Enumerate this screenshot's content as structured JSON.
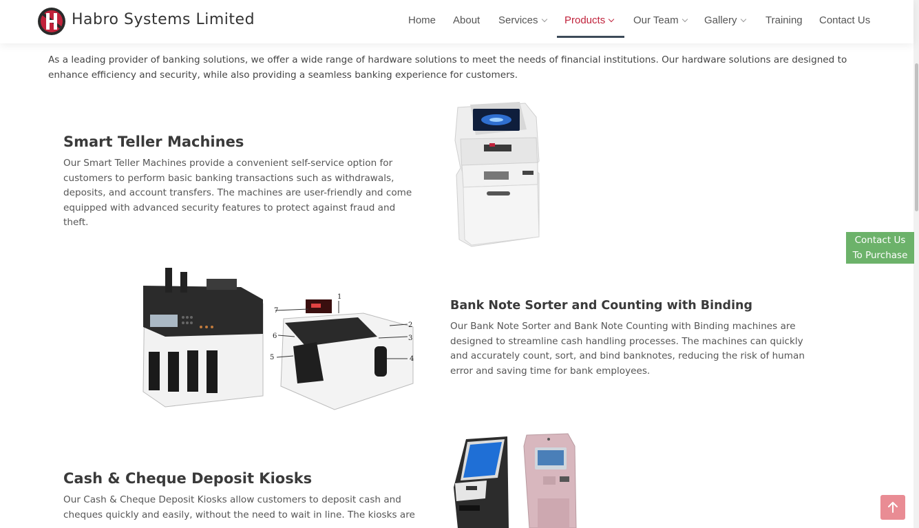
{
  "brand": {
    "name": "Habro Systems Limited"
  },
  "nav": {
    "items": [
      {
        "label": "Home",
        "dropdown": false
      },
      {
        "label": "About",
        "dropdown": false
      },
      {
        "label": "Services",
        "dropdown": true
      },
      {
        "label": "Products",
        "dropdown": true,
        "active": true
      },
      {
        "label": "Our Team",
        "dropdown": true
      },
      {
        "label": "Gallery",
        "dropdown": true
      },
      {
        "label": "Training",
        "dropdown": false
      },
      {
        "label": "Contact Us",
        "dropdown": false
      }
    ]
  },
  "intro": "As a leading provider of banking solutions, we offer a wide range of hardware solutions to meet the needs of financial institutions. Our hardware solutions are designed to enhance efficiency and security, while also providing a seamless banking experience for customers.",
  "products": [
    {
      "title": "Smart Teller Machines",
      "description": "Our Smart Teller Machines provide a convenient self-service option for customers to perform basic banking transactions such as withdrawals, deposits, and account transfers. The machines are user-friendly and come equipped with advanced security features to protect against fraud and theft."
    },
    {
      "title": "Bank Note Sorter and Counting with Binding",
      "description": "Our Bank Note Sorter and Bank Note Counting with Binding machines are designed to streamline cash handling processes. The machines can quickly and accurately count, sort, and bind banknotes, reducing the risk of human error and saving time for bank employees.",
      "diagram_labels": [
        "1",
        "2",
        "3",
        "4",
        "5",
        "6",
        "7"
      ]
    },
    {
      "title": "Cash & Cheque Deposit Kiosks",
      "description": "Our Cash & Cheque Deposit Kiosks allow customers to deposit cash and cheques quickly and easily, without the need to wait in line. The kiosks are"
    }
  ],
  "floating": {
    "contact_line1": "Contact Us",
    "contact_line2": "To Purchase"
  },
  "colors": {
    "accent": "#c0223b",
    "contact_green": "#6cb26a",
    "back_to_top": "#e98c94",
    "nav_underline": "#3c4a58"
  },
  "icons": {
    "back_to_top": "arrow-up-icon",
    "logo": "habro-logo-icon"
  }
}
